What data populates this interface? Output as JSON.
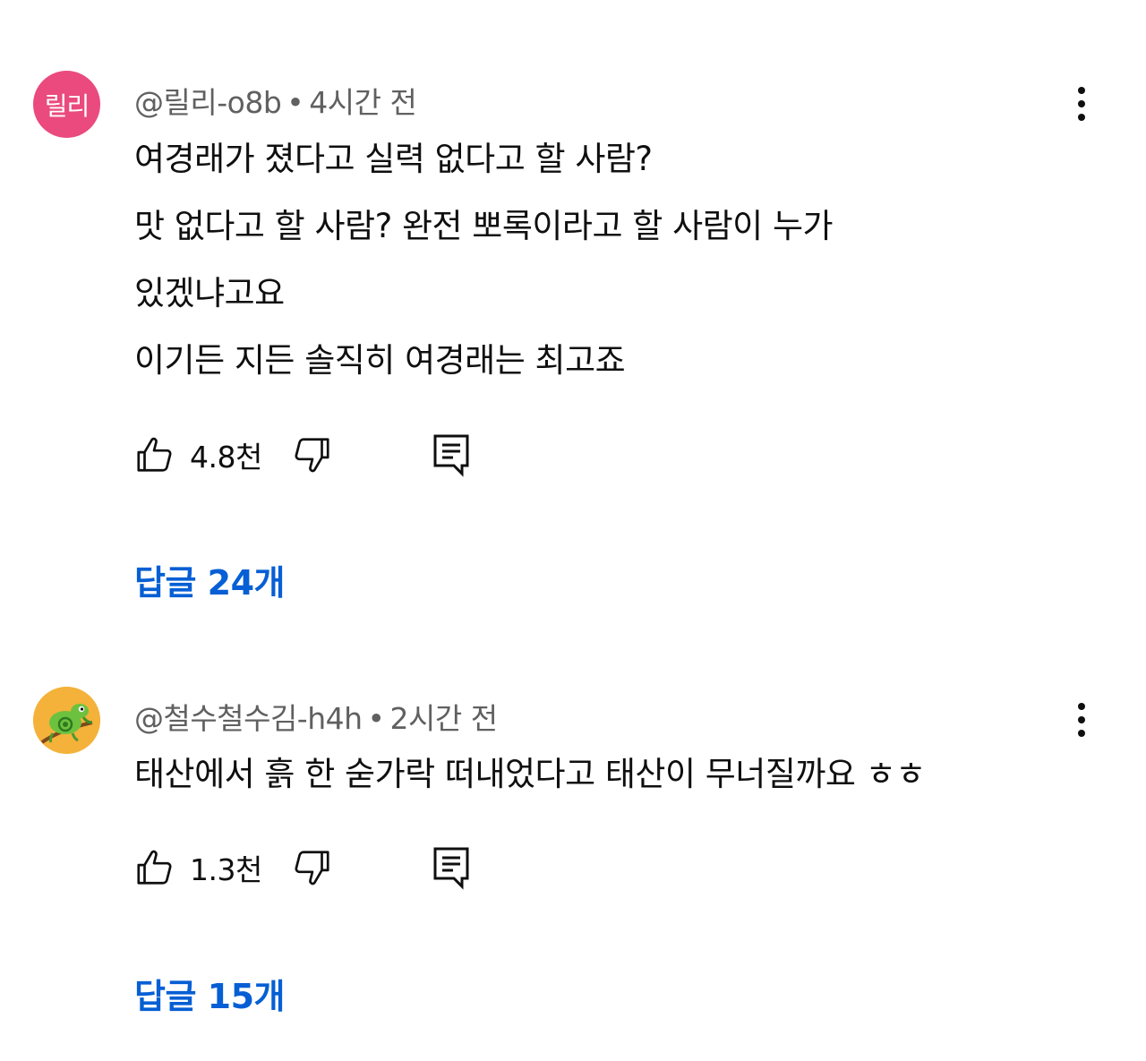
{
  "comments": [
    {
      "avatar_text": "릴리",
      "author": "@릴리-o8b",
      "time": "4시간 전",
      "lines": [
        "여경래가 졌다고 실력 없다고 할 사람?",
        "맛 없다고 할 사람? 완전 뽀록이라고 할 사람이 누가",
        "있겠냐고요",
        "이기든 지든 솔직히 여경래는 최고죠"
      ],
      "likes": "4.8천",
      "replies": "답글 24개",
      "avatar_color": "#ea4a7e"
    },
    {
      "author": "@철수철수김-h4h",
      "time": "2시간 전",
      "lines": [
        "태산에서 흙 한 숟가락 떠내었다고 태산이 무너질까요 ㅎㅎ"
      ],
      "likes": "1.3천",
      "replies": "답글 15개",
      "avatar_icon": "chameleon"
    }
  ],
  "separator": "•",
  "colors": {
    "reply_link": "#065fd4",
    "meta_text": "#606060"
  }
}
